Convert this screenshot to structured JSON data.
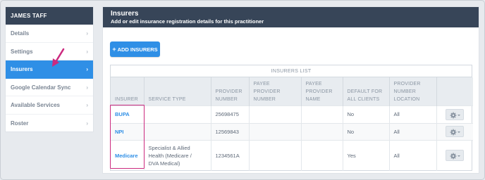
{
  "sidebar": {
    "header": "JAMES TAFF",
    "items": [
      {
        "label": "Details",
        "chevron": "›"
      },
      {
        "label": "Settings",
        "chevron": "›"
      },
      {
        "label": "Insurers",
        "chevron": "›"
      },
      {
        "label": "Google Calendar Sync",
        "chevron": "›"
      },
      {
        "label": "Available Services",
        "chevron": "›"
      },
      {
        "label": "Roster",
        "chevron": "›"
      }
    ]
  },
  "main": {
    "title": "Insurers",
    "subtitle": "Add or edit insurance registration details for this practitioner",
    "add_button": {
      "icon": "+",
      "label": "ADD INSURERS"
    },
    "table": {
      "caption": "INSURERS LIST",
      "headers": {
        "insurer": "INSURER",
        "service_type": "SERVICE TYPE",
        "provider_number_1": "PROVIDER",
        "provider_number_2": "NUMBER",
        "payee_provider_number_1": "PAYEE",
        "payee_provider_number_2": "PROVIDER",
        "payee_provider_number_3": "NUMBER",
        "payee_provider_name_1": "PAYEE",
        "payee_provider_name_2": "PROVIDER",
        "payee_provider_name_3": "NAME",
        "default_1": "DEFAULT FOR",
        "default_2": "ALL CLIENTS",
        "location_1": "PROVIDER",
        "location_2": "NUMBER",
        "location_3": "LOCATION"
      },
      "rows": [
        {
          "insurer": "BUPA",
          "service_type": "",
          "provider_number": "25698475",
          "payee_provider_number": "",
          "payee_provider_name": "",
          "default_for_all": "No",
          "location": "All"
        },
        {
          "insurer": "NPI",
          "service_type": "",
          "provider_number": "12569843",
          "payee_provider_number": "",
          "payee_provider_name": "",
          "default_for_all": "No",
          "location": "All"
        },
        {
          "insurer": "Medicare",
          "service_type_1": "Specialist & Allied",
          "service_type_2": "Health (Medicare /",
          "service_type_3": "DVA Medical)",
          "provider_number": "1234561A",
          "payee_provider_number": "",
          "payee_provider_name": "",
          "default_for_all": "Yes",
          "location": "All"
        }
      ]
    }
  },
  "icons": {
    "row_action": "gear-icon",
    "add": "plus-icon",
    "nav": "chevron-right-icon"
  },
  "colors": {
    "header_bg": "#374558",
    "accent": "#2f8fe6",
    "annotation": "#cc2a7f"
  }
}
